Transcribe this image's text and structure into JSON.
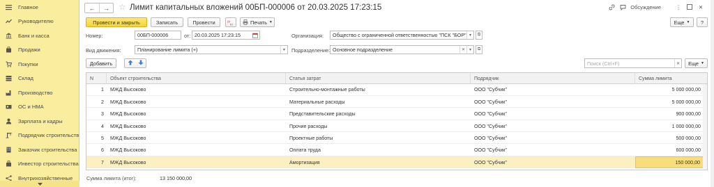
{
  "sidebar": {
    "items": [
      {
        "label": "Главное",
        "icon": "menu-icon"
      },
      {
        "label": "Руководителю",
        "icon": "chart-line-icon"
      },
      {
        "label": "Банк и касса",
        "icon": "bank-icon"
      },
      {
        "label": "Продажи",
        "icon": "cart-icon"
      },
      {
        "label": "Покупки",
        "icon": "basket-icon"
      },
      {
        "label": "Склад",
        "icon": "warehouse-icon"
      },
      {
        "label": "Производство",
        "icon": "factory-icon"
      },
      {
        "label": "ОС и НМА",
        "icon": "assets-icon"
      },
      {
        "label": "Зарплата и кадры",
        "icon": "person-icon"
      },
      {
        "label": "Подрядчик строительства",
        "icon": "crane-icon"
      },
      {
        "label": "Заказчик строительства",
        "icon": "building-icon"
      },
      {
        "label": "Инвестор строительства",
        "icon": "investor-icon"
      },
      {
        "label": "Внутрихозяйственные",
        "icon": "network-icon"
      }
    ]
  },
  "header": {
    "title": "Лимит капитальных вложений 00БП-000006 от 20.03.2025 17:23:15",
    "discussion_label": "Обсуждение"
  },
  "toolbar": {
    "post_close_label": "Провести и закрыть",
    "save_label": "Записать",
    "post_label": "Провести",
    "print_label": "Печать",
    "more_label": "Еще",
    "help_label": "?"
  },
  "form": {
    "number_label": "Номер:",
    "number_value": "00БП-000006",
    "date_label": "от:",
    "date_value": "20.03.2025 17:23:15",
    "org_label": "Организация:",
    "org_value": "Общество с ограниченной ответственностью \"ПСК \"БОР\"",
    "movement_label": "Вид движения:",
    "movement_value": "Планирование лимита (+)",
    "division_label": "Подразделение:",
    "division_value": "Основное подразделение"
  },
  "table_toolbar": {
    "add_label": "Добавить",
    "search_placeholder": "Поиск (Ctrl+F)",
    "more_label": "Еще"
  },
  "table": {
    "columns": [
      "N",
      "Объект строительства",
      "Статья затрат",
      "Подрядчик",
      "Сумма лимита"
    ],
    "rows": [
      {
        "n": "1",
        "object": "МЖД Высоково",
        "cost_item": "Строительно-монтажные работы",
        "contractor": "ООО \"Субчик\"",
        "amount": "5 000 000,00"
      },
      {
        "n": "2",
        "object": "МЖД Высоково",
        "cost_item": "Материальные расходы",
        "contractor": "ООО \"Субчик\"",
        "amount": "5 000 000,00"
      },
      {
        "n": "3",
        "object": "МЖД Высоково",
        "cost_item": "Представительские расходы",
        "contractor": "ООО \"Субчик\"",
        "amount": "900 000,00"
      },
      {
        "n": "4",
        "object": "МЖД Высоково",
        "cost_item": "Прочие расходы",
        "contractor": "ООО \"Субчик\"",
        "amount": "1 000 000,00"
      },
      {
        "n": "5",
        "object": "МЖД Высоково",
        "cost_item": "Проектные работы",
        "contractor": "ООО \"Субчик\"",
        "amount": "500 000,00"
      },
      {
        "n": "6",
        "object": "МЖД Высоково",
        "cost_item": "Оплата труда",
        "contractor": "ООО \"Субчик\"",
        "amount": "600 000,00"
      },
      {
        "n": "7",
        "object": "МЖД Высоково",
        "cost_item": "Амортизация",
        "contractor": "ООО \"Субчик\"",
        "amount": "150 000,00"
      }
    ],
    "selected_row": 7
  },
  "footer": {
    "total_label": "Сумма лимита (итог):",
    "total_value": "13 150 000,00"
  },
  "colors": {
    "sidebar_bg": "#fbed9e",
    "primary_button": "#f7d438",
    "selected_row": "#fcf0c2",
    "arrow_blue": "#3a7fd4"
  }
}
